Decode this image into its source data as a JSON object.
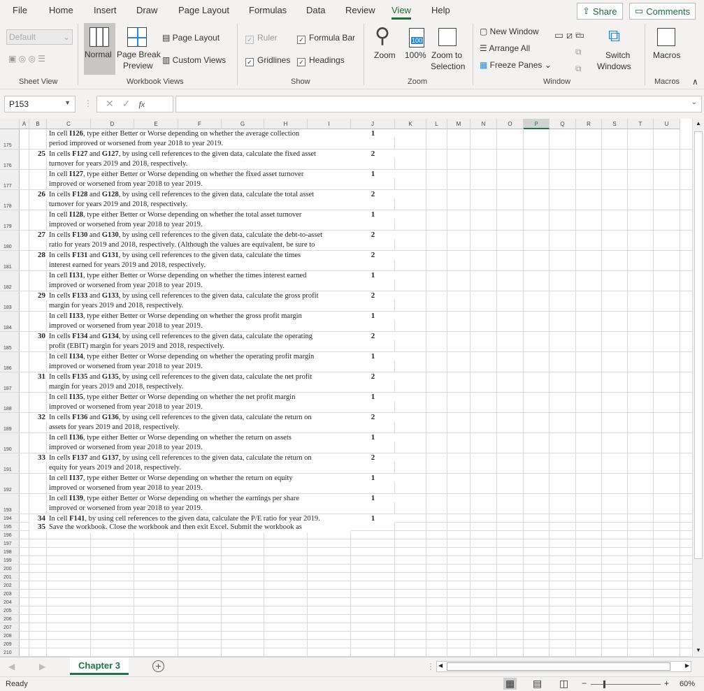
{
  "menu": {
    "tabs": [
      "File",
      "Home",
      "Insert",
      "Draw",
      "Page Layout",
      "Formulas",
      "Data",
      "Review",
      "View",
      "Help"
    ],
    "active": "View",
    "share": "Share",
    "comments": "Comments"
  },
  "ribbon": {
    "sheet_view": {
      "select": "Default",
      "label": "Sheet View"
    },
    "workbook_views": {
      "normal": "Normal",
      "page_break": "Page Break",
      "page_break2": "Preview",
      "page_layout": "Page Layout",
      "custom_views": "Custom Views",
      "label": "Workbook Views"
    },
    "show": {
      "ruler": "Ruler",
      "formula_bar": "Formula Bar",
      "gridlines": "Gridlines",
      "headings": "Headings",
      "label": "Show",
      "ruler_checked": true,
      "formula_bar_checked": true,
      "gridlines_checked": true,
      "headings_checked": true
    },
    "zoom": {
      "zoom": "Zoom",
      "hundred": "100%",
      "hundred_icon": "100",
      "zoom_sel1": "Zoom to",
      "zoom_sel2": "Selection",
      "label": "Zoom"
    },
    "window": {
      "new_window": "New Window",
      "arrange_all": "Arrange All",
      "freeze": "Freeze Panes",
      "switch1": "Switch",
      "switch2": "Windows",
      "label": "Window"
    },
    "macros": {
      "macros": "Macros",
      "label": "Macros"
    }
  },
  "formula_bar": {
    "name_box": "P153",
    "fx": "fx",
    "value": ""
  },
  "columns": [
    "A",
    "B",
    "C",
    "D",
    "E",
    "F",
    "G",
    "H",
    "I",
    "J",
    "K",
    "L",
    "M",
    "N",
    "O",
    "P",
    "Q",
    "R",
    "S",
    "T",
    "U"
  ],
  "selected_column": "P",
  "rows": [
    {
      "n": "175",
      "b": "",
      "lines": [
        "In cell I126, type either Better or Worse depending on whether the average collection",
        "period improved or worsened from year 2018 to year 2019."
      ],
      "j": "1"
    },
    {
      "n": "176",
      "b": "25",
      "lines": [
        "In cells F127 and G127, by using cell references to the given data, calculate the fixed asset",
        "turnover for years 2019 and 2018, respectively."
      ],
      "j": "2"
    },
    {
      "n": "177",
      "b": "",
      "lines": [
        "In cell I127, type either Better or Worse depending on whether the fixed asset turnover",
        "improved or worsened from year 2018 to year 2019."
      ],
      "j": "1"
    },
    {
      "n": "178",
      "b": "26",
      "lines": [
        "In cells F128 and G128, by using cell references to the given data, calculate the total asset",
        "turnover for years 2019 and 2018, respectively."
      ],
      "j": "2"
    },
    {
      "n": "179",
      "b": "",
      "lines": [
        "In cell I128, type either Better or Worse depending on whether the total asset turnover",
        "improved or worsened from year 2018 to year 2019."
      ],
      "j": "1"
    },
    {
      "n": "180",
      "b": "27",
      "lines": [
        "In cells F130 and G130, by using cell references to the given data, calculate the debt-to-asset",
        "ratio for years 2019 and 2018, respectively. (Although the values are equivalent, be sure to"
      ],
      "j": "2"
    },
    {
      "n": "181",
      "b": "28",
      "lines": [
        "In cells F131 and G131, by using cell references to the given data, calculate the times",
        "interest earned for years 2019 and 2018, respectively."
      ],
      "j": "2"
    },
    {
      "n": "182",
      "b": "",
      "lines": [
        "In cell I131, type either Better or Worse depending on whether the times interest earned",
        "improved or worsened from year 2018 to year 2019."
      ],
      "j": "1"
    },
    {
      "n": "183",
      "b": "29",
      "lines": [
        "In cells F133 and G133, by using cell references to the given data, calculate the gross profit",
        "margin for years 2019 and 2018, respectively."
      ],
      "j": "2"
    },
    {
      "n": "184",
      "b": "",
      "lines": [
        "In cell I133, type either Better or Worse depending on whether the gross profit margin",
        "improved or worsened from year 2018 to year 2019."
      ],
      "j": "1"
    },
    {
      "n": "185",
      "b": "30",
      "lines": [
        "In cells F134 and G134, by using cell references to the given data, calculate the operating",
        "profit (EBIT) margin for years 2019 and 2018, respectively."
      ],
      "j": "2"
    },
    {
      "n": "186",
      "b": "",
      "lines": [
        "In cell I134, type either Better or Worse depending on whether the operating profit margin",
        "improved or worsened from year 2018 to year 2019."
      ],
      "j": "1"
    },
    {
      "n": "187",
      "b": "31",
      "lines": [
        "In cells F135 and G135, by using cell references to the given data, calculate the net profit",
        "margin for years 2019 and 2018, respectively."
      ],
      "j": "2"
    },
    {
      "n": "188",
      "b": "",
      "lines": [
        "In cell I135, type either Better or Worse depending on whether the net profit margin",
        "improved or worsened from year 2018 to year 2019."
      ],
      "j": "1"
    },
    {
      "n": "189",
      "b": "32",
      "lines": [
        "In cells F136 and G136, by using cell references to the given data, calculate the return on",
        "assets for years 2019 and 2018, respectively."
      ],
      "j": "2"
    },
    {
      "n": "190",
      "b": "",
      "lines": [
        "In cell I136, type either Better or Worse depending on whether the return on assets",
        "improved or worsened from year 2018 to year 2019."
      ],
      "j": "1"
    },
    {
      "n": "191",
      "b": "33",
      "lines": [
        "In cells F137 and G137, by using cell references to the given data, calculate the return on",
        "equity for years 2019 and 2018, respectively."
      ],
      "j": "2"
    },
    {
      "n": "192",
      "b": "",
      "lines": [
        "In cell I137, type either Better or Worse depending on whether the return on equity",
        "improved or worsened from year 2018 to year 2019."
      ],
      "j": "1"
    },
    {
      "n": "193",
      "b": "",
      "lines": [
        "In cell I139, type either Better or Worse depending on whether the earnings per share",
        "improved or worsened from year 2018 to year 2019."
      ],
      "j": "1"
    },
    {
      "n": "194",
      "b": "34",
      "lines": [
        "In cell F141, by using cell references to the given data, calculate the P/E ratio for year 2019."
      ],
      "j": "1"
    },
    {
      "n": "195",
      "b": "35",
      "lines": [
        "Save the workbook. Close the workbook and then exit Excel. Submit the workbook as"
      ],
      "j": ""
    },
    {
      "n": "196"
    },
    {
      "n": "197"
    },
    {
      "n": "198"
    },
    {
      "n": "199"
    },
    {
      "n": "200"
    },
    {
      "n": "201"
    },
    {
      "n": "202"
    },
    {
      "n": "203"
    },
    {
      "n": "204"
    },
    {
      "n": "205"
    },
    {
      "n": "206"
    },
    {
      "n": "207"
    },
    {
      "n": "208"
    },
    {
      "n": "209"
    },
    {
      "n": "210"
    }
  ],
  "sheet_tabs": {
    "active": "Chapter 3",
    "add": "+"
  },
  "status": {
    "text": "Ready",
    "zoom": "60%",
    "zoom_level_percent": 60
  },
  "colors": {
    "accent": "#217346",
    "ribbon_bg": "#f3f2f1"
  }
}
